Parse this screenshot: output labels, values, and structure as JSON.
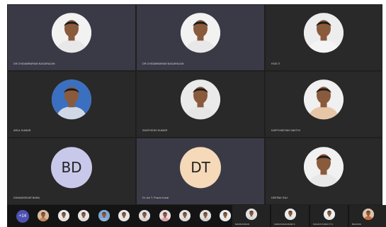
{
  "tiles": [
    {
      "name": "DR.CHIDAMBARAM NAGARAJAN",
      "kind": "photo",
      "shirt": "#e8e8e8",
      "bg": "#f2f2f2",
      "active": true
    },
    {
      "name": "DR.CHIDAMBARAM NAGARAJAN",
      "kind": "photo",
      "shirt": "#e8e8e8",
      "bg": "#f2f2f2",
      "active": true
    },
    {
      "name": "HOD IT",
      "kind": "photo",
      "shirt": "#f4f4f4",
      "bg": "#ededed",
      "active": false
    },
    {
      "name": "ARUL KUMAR",
      "kind": "photo",
      "shirt": "#d0d8e6",
      "bg": "#3b6fc0",
      "active": false
    },
    {
      "name": "SANTHOSH KUMAR",
      "kind": "photo",
      "shirt": "#e6e6e6",
      "bg": "#eaeaea",
      "active": false
    },
    {
      "name": "KARTHIKEYAN SAKTHI",
      "kind": "photo",
      "shirt": "#e7c6a8",
      "bg": "#f0f0f0",
      "active": false
    },
    {
      "name": "DHANASEKAR BANU",
      "kind": "initials",
      "initials": "BD",
      "circle": "#c8c9ea",
      "active": false
    },
    {
      "name": "Dr. Avi T. Pravin Durai",
      "kind": "initials",
      "initials": "DT",
      "circle": "#f5d9b8",
      "active": true
    },
    {
      "name": "DEEPAK RAJ",
      "kind": "photo",
      "shirt": "#e8e8e8",
      "bg": "#f1f1f1",
      "active": false
    }
  ],
  "strip": {
    "more_count": "+14",
    "avatars": [
      {
        "shirt": "#c9845a",
        "bg": "#d9b99c"
      },
      {
        "shirt": "#e0e0e0",
        "bg": "#eaeaea"
      },
      {
        "shirt": "#dddddd",
        "bg": "#e6e6e6"
      },
      {
        "shirt": "#8fb2d8",
        "bg": "#7da6d6"
      },
      {
        "shirt": "#e2e2e2",
        "bg": "#e8e8e8"
      },
      {
        "shirt": "#d2d2d2",
        "bg": "#e0e0e0"
      },
      {
        "shirt": "#e0a0b0",
        "bg": "#eadde0"
      },
      {
        "shirt": "#d8d8d8",
        "bg": "#e4e4e4"
      },
      {
        "shirt": "#d0d0d0",
        "bg": "#e2e2e2"
      },
      {
        "shirt": "#e6e6e6",
        "bg": "#ececec"
      }
    ],
    "named": [
      {
        "name": "MANIKANDAN",
        "shirt": "#d8d8d8",
        "bg": "#e2e2e2"
      },
      {
        "name": "SARAVANAKUMAR S",
        "shirt": "#e4e4e4",
        "bg": "#eaeaea"
      },
      {
        "name": "SUGANYA DEVI P S",
        "shirt": "#e6e6e6",
        "bg": "#efefef"
      },
      {
        "name": "BHAVANI",
        "shirt": "#c86a3a",
        "bg": "#e0c0a8"
      }
    ]
  }
}
